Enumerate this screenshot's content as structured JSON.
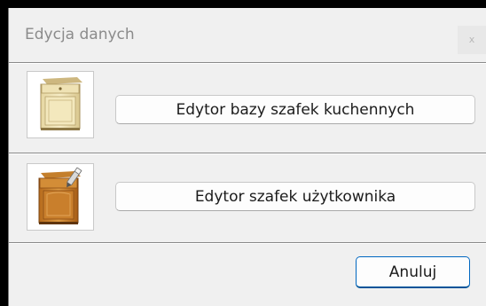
{
  "window": {
    "title": "Edycja danych",
    "close_label": "x"
  },
  "options": [
    {
      "label": "Edytor bazy szafek kuchennych",
      "icon": "kitchen-cabinet-icon"
    },
    {
      "label": "Edytor szafek użytkownika",
      "icon": "user-cabinet-icon"
    }
  ],
  "footer": {
    "cancel_label": "Anuluj"
  },
  "colors": {
    "dialog_bg": "#f0f0f0",
    "accent": "#0067c0"
  }
}
